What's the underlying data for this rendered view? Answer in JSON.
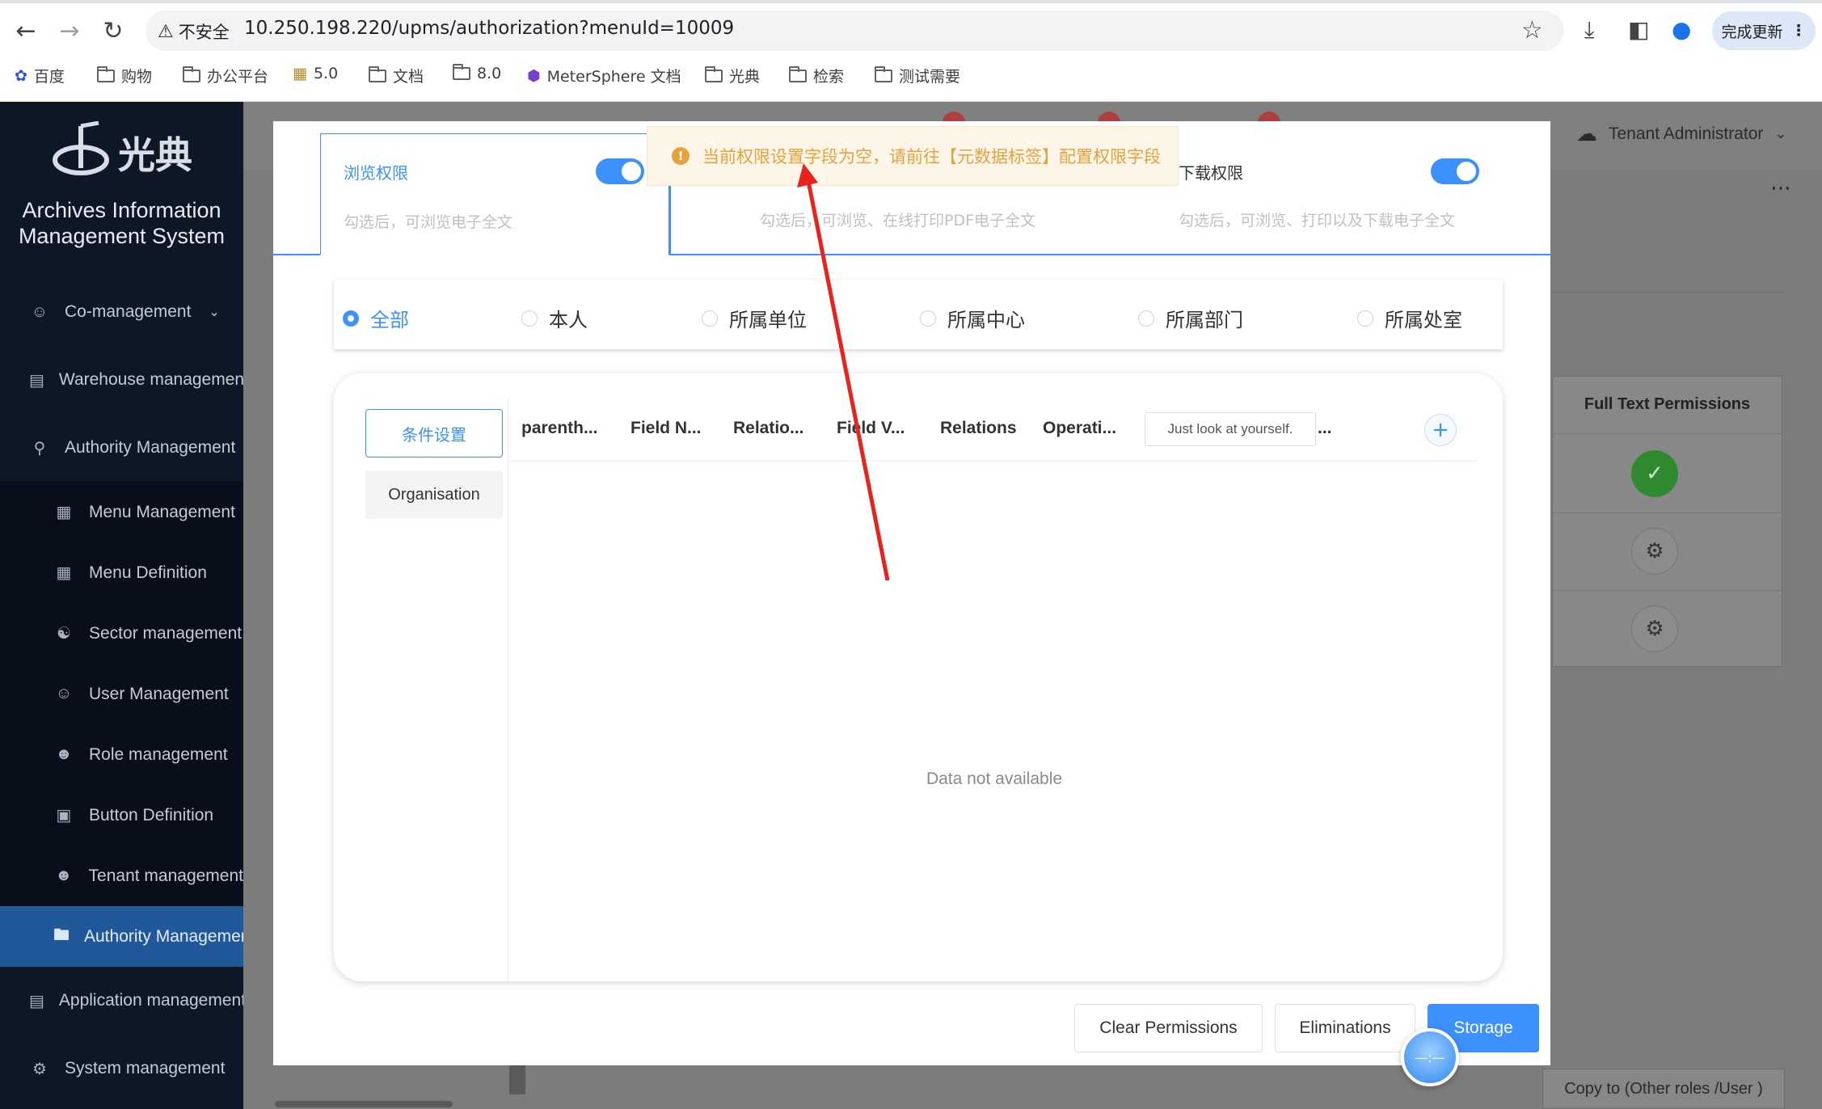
{
  "browser": {
    "insecure_label": "不安全",
    "url": "10.250.198.220/upms/authorization?menuId=10009",
    "update_label": "完成更新",
    "bookmarks": [
      "百度",
      "购物",
      "办公平台",
      "5.0",
      "文档",
      "8.0",
      "MeterSphere 文档",
      "光典",
      "检索",
      "测试需要"
    ]
  },
  "sidebar": {
    "logo_text": "光典",
    "system_name_1": "Archives Information",
    "system_name_2": "Management System",
    "items": [
      {
        "label": "Co-management"
      },
      {
        "label": "Warehouse management"
      },
      {
        "label": "Authority Management"
      },
      {
        "label": "Menu Management"
      },
      {
        "label": "Menu Definition"
      },
      {
        "label": "Sector management"
      },
      {
        "label": "User Management"
      },
      {
        "label": "Role management"
      },
      {
        "label": "Button Definition"
      },
      {
        "label": "Tenant management"
      },
      {
        "label": "Authority Management"
      },
      {
        "label": "Application management"
      },
      {
        "label": "System management"
      }
    ]
  },
  "header": {
    "user": "Tenant Administrator"
  },
  "background_panel": {
    "column_title": "Full Text Permissions",
    "copy_button": "Copy to (Other roles /User )"
  },
  "toast": {
    "message": "当前权限设置字段为空，请前往【元数据标签】配置权限字段"
  },
  "permissions": {
    "browse_title": "浏览权限",
    "browse_desc": "勾选后，可浏览电子全文",
    "print_desc": "勾选后，可浏览、在线打印PDF电子全文",
    "download_title": "下载权限",
    "download_desc": "勾选后，可浏览、打印以及下载电子全文"
  },
  "scope": {
    "options": [
      "全部",
      "本人",
      "所属单位",
      "所属中心",
      "所属部门",
      "所属处室"
    ],
    "selected": "全部"
  },
  "conditions": {
    "tab_condition": "条件设置",
    "tab_org": "Organisation",
    "columns": [
      "parenth...",
      "Field N...",
      "Relatio...",
      "Field V...",
      "Relations",
      "Operati..."
    ],
    "input_value": "Just look at yourself.",
    "more": "...",
    "empty_text": "Data not available"
  },
  "footer": {
    "clear": "Clear Permissions",
    "eliminations": "Eliminations",
    "storage": "Storage"
  },
  "colors": {
    "primary": "#3c91ff",
    "warning": "#e6a23c",
    "sidebar_bg": "#0e1726",
    "sidebar_active": "#20589a",
    "annotation_arrow": "#e8231b"
  }
}
